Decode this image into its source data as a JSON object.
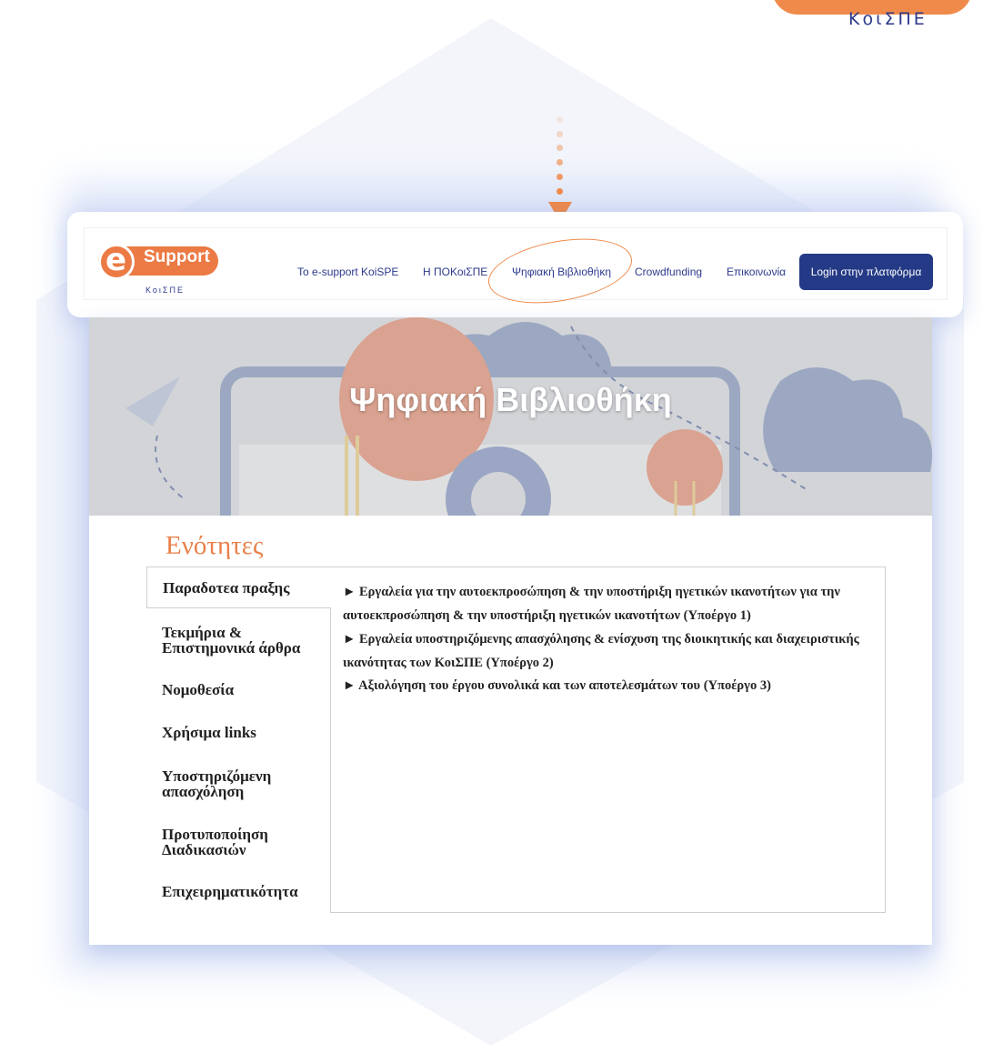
{
  "corner": {
    "brand": "ΚοιΣΠΕ"
  },
  "nav": {
    "logo_letter": "e",
    "logo_word": "Support",
    "logo_sub": "ΚοιΣΠΕ",
    "links": [
      "Το e-support KoiSPE",
      "Η ΠΟΚοιΣΠΕ",
      "Ψηφιακή Βιβλιοθήκη",
      "Crowdfunding",
      "Επικοινωνία"
    ],
    "login_label": "Login στην πλατφόρμα"
  },
  "hero": {
    "title": "Ψηφιακή Βιβλιοθήκη"
  },
  "sections": {
    "title": "Ενότητες",
    "tabs": [
      "Παραδοτεα πραξης",
      "Τεκμήρια & Επιστημονικά άρθρα",
      "Νομοθεσία",
      "Χρήσιμα links",
      "Υποστηριζόμενη απασχόληση",
      "Προτυποποίηση Διαδικασιών",
      "Επιχειρηματικότητα"
    ],
    "active_tab": "Παραδοτεα πραξης",
    "items": [
      "► Εργαλεία για την αυτοεκπροσώπηση & την υποστήριξη ηγετικών ικανοτήτων για την αυτοεκπροσώπηση & την υποστήριξη ηγετικών ικανοτήτων (Υποέργο 1)",
      "► Εργαλεία υποστηριζόμενης απασχόλησης & ενίσχυση της διοικητικής και διαχειριστικής ικανότητας των ΚοιΣΠΕ (Υποέργο 2)",
      "► Αξιολόγηση του έργου συνολικά και των αποτελεσμάτων του (Υποέργο 3)"
    ]
  }
}
